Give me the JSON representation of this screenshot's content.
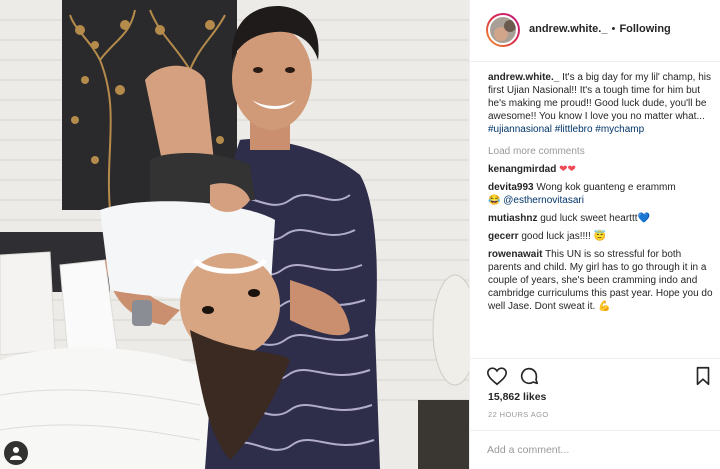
{
  "post": {
    "username": "andrew.white._",
    "separator": "•",
    "follow_status": "Following",
    "caption": {
      "username": "andrew.white._",
      "text": " It's a big day for my lil' champ, his first Ujian Nasional!! It's a tough time for him but he's making me proud!! Good luck dude, you'll be awesome!! You know I love you no matter what...",
      "hashtags": "#ujiannasional #littlebro #mychamp"
    },
    "load_more": "Load more comments",
    "comments": [
      {
        "user": "kenangmirdad",
        "text": " ",
        "emoji": "❤❤"
      },
      {
        "user": "devita993",
        "text": " Wong kok guanteng e erammm",
        "emoji": "😂",
        "mention": "@esthernovitasari"
      },
      {
        "user": "mutiashnz",
        "text": " gud luck sweet hearttt",
        "emoji": "💙"
      },
      {
        "user": "gecerr",
        "text": " good luck jas!!!! ",
        "emoji": "😇"
      },
      {
        "user": "rowenawait",
        "text": " This UN is so stressful for both parents and child. My girl has to go through it in a couple of years, she's been cramming indo and cambridge curriculums this past year. Hope you do well Jase. Dont sweat it. ",
        "emoji": "💪"
      }
    ],
    "likes": "15,862 likes",
    "time_ago": "22 HOURS AGO",
    "comment_placeholder": "Add a comment..."
  },
  "colors": {
    "heart": "#ed4956",
    "link": "#003569",
    "muted": "#999999",
    "text": "#262626"
  },
  "icons": {
    "tag": "person-tag-icon",
    "like": "heart-icon",
    "comment": "comment-bubble-icon",
    "save": "bookmark-icon"
  }
}
